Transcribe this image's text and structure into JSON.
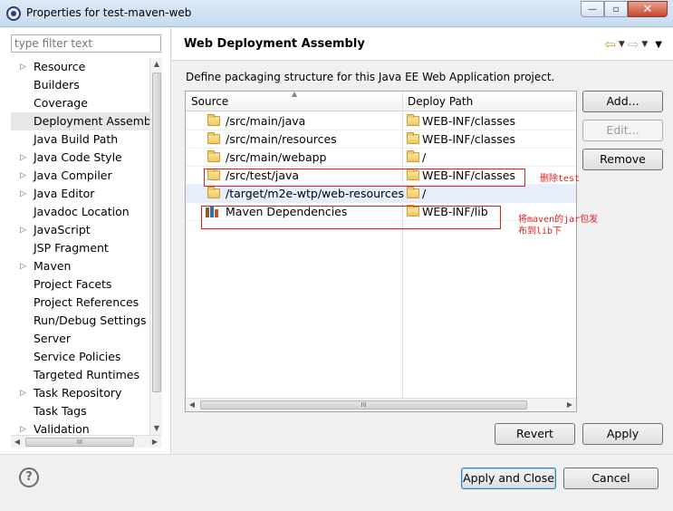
{
  "window": {
    "title": "Properties for test-maven-web",
    "minimize_glyph": "—",
    "restore_glyph": "▫",
    "close_glyph": "✕"
  },
  "filter": {
    "placeholder": "type filter text"
  },
  "tree": [
    {
      "label": "Resource",
      "expandable": true
    },
    {
      "label": "Builders",
      "expandable": false
    },
    {
      "label": "Coverage",
      "expandable": false
    },
    {
      "label": "Deployment Assembly",
      "expandable": false,
      "selected": true
    },
    {
      "label": "Java Build Path",
      "expandable": false
    },
    {
      "label": "Java Code Style",
      "expandable": true
    },
    {
      "label": "Java Compiler",
      "expandable": true
    },
    {
      "label": "Java Editor",
      "expandable": true
    },
    {
      "label": "Javadoc Location",
      "expandable": false
    },
    {
      "label": "JavaScript",
      "expandable": true
    },
    {
      "label": "JSP Fragment",
      "expandable": false
    },
    {
      "label": "Maven",
      "expandable": true
    },
    {
      "label": "Project Facets",
      "expandable": false
    },
    {
      "label": "Project References",
      "expandable": false
    },
    {
      "label": "Run/Debug Settings",
      "expandable": false
    },
    {
      "label": "Server",
      "expandable": false
    },
    {
      "label": "Service Policies",
      "expandable": false
    },
    {
      "label": "Targeted Runtimes",
      "expandable": false
    },
    {
      "label": "Task Repository",
      "expandable": true
    },
    {
      "label": "Task Tags",
      "expandable": false
    },
    {
      "label": "Validation",
      "expandable": true
    }
  ],
  "page": {
    "title": "Web Deployment Assembly",
    "description": "Define packaging structure for this Java EE Web Application project."
  },
  "table": {
    "headers": {
      "source": "Source",
      "deploy_path": "Deploy Path"
    },
    "rows": [
      {
        "source": "/src/main/java",
        "path": "WEB-INF/classes",
        "icon": "folder-icon"
      },
      {
        "source": "/src/main/resources",
        "path": "WEB-INF/classes",
        "icon": "folder-icon"
      },
      {
        "source": "/src/main/webapp",
        "path": "/",
        "icon": "folder-icon"
      },
      {
        "source": "/src/test/java",
        "path": "WEB-INF/classes",
        "icon": "folder-icon"
      },
      {
        "source": "/target/m2e-wtp/web-resources",
        "path": "/",
        "icon": "folder-icon",
        "selected": true
      },
      {
        "source": "Maven Dependencies",
        "path": "WEB-INF/lib",
        "icon": "library-icon"
      }
    ]
  },
  "buttons": {
    "add": "Add...",
    "edit": "Edit...",
    "remove": "Remove",
    "revert": "Revert",
    "apply": "Apply",
    "apply_close": "Apply and Close",
    "cancel": "Cancel",
    "help": "?"
  },
  "annotations": {
    "remove_test": "删除test",
    "maven_jar_line1": "将maven的jar包发",
    "maven_jar_line2": "布到lib下"
  },
  "colors": {
    "annotation": "#e02020",
    "selection": "#e5eefa"
  }
}
